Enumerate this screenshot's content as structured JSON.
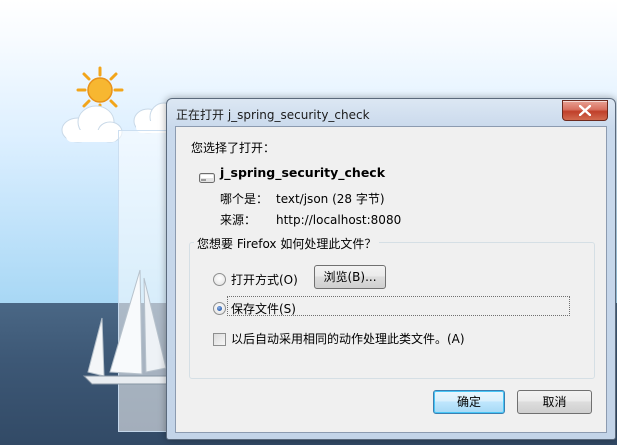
{
  "dialog": {
    "title": "正在打开 j_spring_security_check",
    "heading": "您选择了打开：",
    "file": {
      "name": "j_spring_security_check",
      "type_label": "哪个是：",
      "type_value": "text/json (28 字节)",
      "source_label": "来源：",
      "source_value": "http://localhost:8080"
    },
    "action_group_title": "您想要 Firefox 如何处理此文件？",
    "options": {
      "open_with_label": "打开方式(O)",
      "open_with_selected": false,
      "browse_label": "浏览(B)...",
      "save_file_label": "保存文件(S)",
      "save_file_selected": true
    },
    "remember_choice": {
      "label": "以后自动采用相同的动作处理此类文件。(A)",
      "checked": false
    },
    "buttons": {
      "ok_label": "确定",
      "cancel_label": "取消"
    }
  }
}
